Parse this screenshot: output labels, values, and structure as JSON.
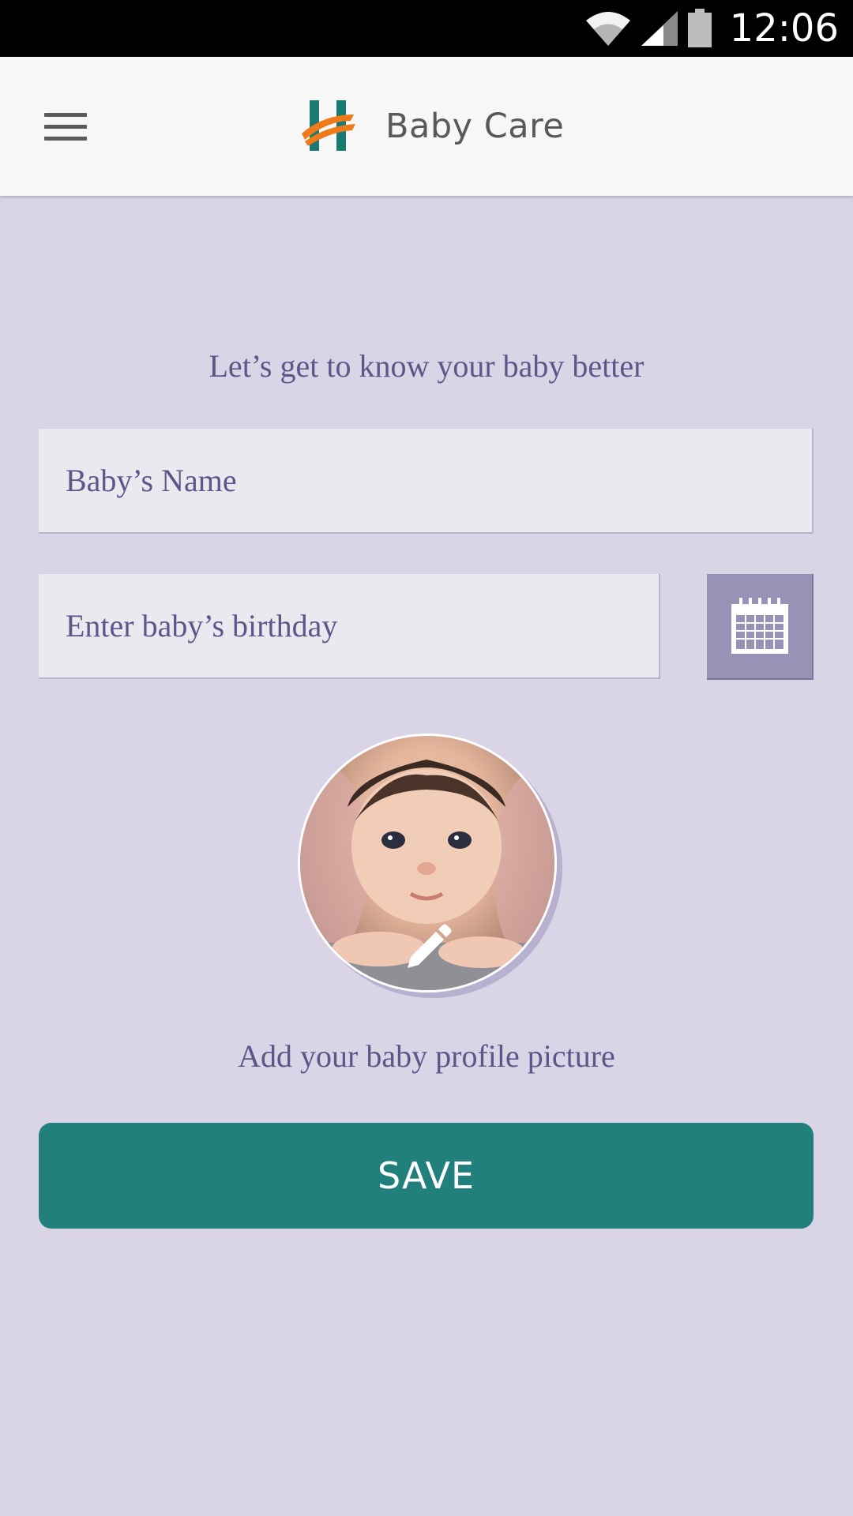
{
  "status_bar": {
    "time": "12:06",
    "icons": [
      "wifi-icon",
      "signal-icon",
      "battery-icon"
    ]
  },
  "app_bar": {
    "menu_icon": "hamburger-menu-icon",
    "logo_icon": "h-logo-icon",
    "title": "Baby Care"
  },
  "form": {
    "intro": "Let’s get to know your baby better",
    "name_placeholder": "Baby’s Name",
    "name_value": "",
    "birthday_placeholder": "Enter baby’s birthday",
    "birthday_value": "",
    "calendar_icon": "calendar-icon",
    "photo_edit_icon": "pencil-edit-icon",
    "photo_caption": "Add your baby profile picture",
    "save_label": "SAVE"
  },
  "colors": {
    "background": "#d9d4e6",
    "accent_purple": "#9a91b7",
    "text_purple": "#5f5588",
    "save_teal": "#22807c",
    "logo_teal": "#1a7a72",
    "logo_orange": "#ef7a1a"
  }
}
